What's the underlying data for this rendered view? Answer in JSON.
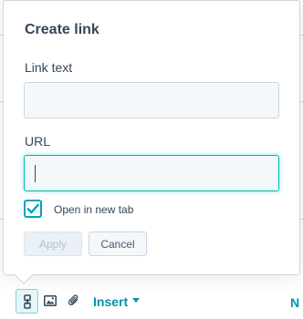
{
  "popover": {
    "title": "Create link",
    "link_text_label": "Link text",
    "link_text_value": "",
    "url_label": "URL",
    "url_value": "",
    "open_new_tab": {
      "label": "Open in new tab",
      "checked": true
    },
    "apply_label": "Apply",
    "cancel_label": "Cancel"
  },
  "toolbar": {
    "icons": [
      "link-icon",
      "image-icon",
      "attachment-icon"
    ],
    "insert_label": "Insert",
    "right_text": "N"
  },
  "colors": {
    "accent": "#00bda5",
    "checkbox": "#00a4bd",
    "link_blue": "#0091ae",
    "text": "#33475b"
  }
}
